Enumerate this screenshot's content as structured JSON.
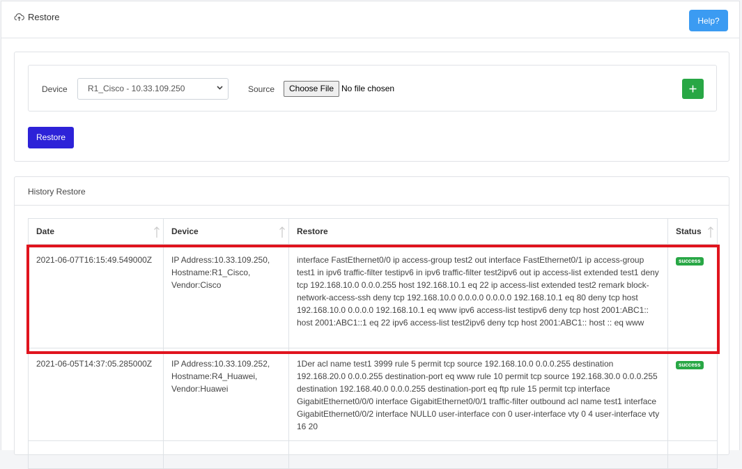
{
  "header": {
    "title": "Restore",
    "title_icon": "cloud-upload-icon",
    "help_label": "Help?"
  },
  "form": {
    "device_label": "Device",
    "device_value": "R1_Cisco - 10.33.109.250",
    "source_label": "Source",
    "choose_file_label": "Choose File",
    "no_file_text": "No file chosen",
    "add_icon": "plus-icon",
    "restore_label": "Restore"
  },
  "history": {
    "title": "History Restore",
    "columns": [
      "Date",
      "Device",
      "Restore",
      "Status"
    ],
    "rows": [
      {
        "date": "2021-06-07T16:15:49.549000Z",
        "device": [
          "IP Address:10.33.109.250,",
          "Hostname:R1_Cisco,",
          "Vendor:Cisco"
        ],
        "restore": "interface FastEthernet0/0 ip access-group test2 out interface FastEthernet0/1 ip access-group test1 in ipv6 traffic-filter testipv6 in ipv6 traffic-filter test2ipv6 out ip access-list extended test1 deny tcp 192.168.10.0 0.0.0.255 host 192.168.10.1 eq 22 ip access-list extended test2 remark block-network-access-ssh deny tcp 192.168.10.0 0.0.0.0 0.0.0.0 192.168.10.1 eq 80 deny tcp host 192.168.10.0 0.0.0.0 192.168.10.1 eq www ipv6 access-list testipv6 deny tcp host 2001:ABC1:: host 2001:ABC1::1 eq 22 ipv6 access-list test2ipv6 deny tcp host 2001:ABC1:: host :: eq www",
        "status": "success"
      },
      {
        "date": "2021-06-05T14:37:05.285000Z",
        "device": [
          "IP Address:10.33.109.252,",
          "Hostname:R4_Huawei,",
          "Vendor:Huawei"
        ],
        "restore": "1Der acl name test1 3999 rule 5 permit tcp source 192.168.10.0 0.0.0.255 destination 192.168.20.0 0.0.0.255 destination-port eq www rule 10 permit tcp source 192.168.30.0 0.0.0.255 destination 192.168.40.0 0.0.0.255 destination-port eq ftp rule 15 permit tcp interface GigabitEthernet0/0/0 interface GigabitEthernet0/0/1 traffic-filter outbound acl name test1 interface GigabitEthernet0/0/2 interface NULL0 user-interface con 0 user-interface vty 0 4 user-interface vty 16 20",
        "status": "success"
      }
    ]
  },
  "colors": {
    "help_button": "#3b9bf2",
    "restore_button": "#2d22d8",
    "add_button": "#28a745",
    "success_badge": "#28a745",
    "highlight_border": "#e0141e"
  }
}
